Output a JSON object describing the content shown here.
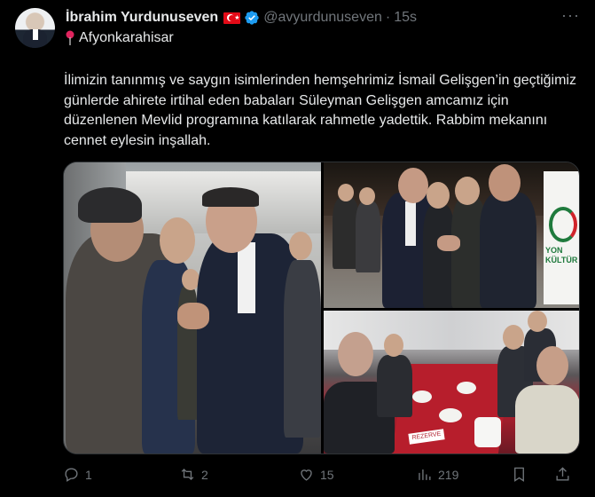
{
  "user": {
    "name": "İbrahim Yurdunuseven",
    "handle": "@avyurdunuseven",
    "time": "15s",
    "location": "Afyonkarahisar"
  },
  "tweet": {
    "text": "İlimizin tanınmış ve saygın isimlerinden hemşehrimiz İsmail Gelişgen’in geçtiğimiz günlerde ahirete irtihal eden babaları Süleyman Gelişgen amcamız için düzenlenen Mevlid programına katılarak rahmetle yadettik. Rabbim mekanını cennet eylesin inşallah."
  },
  "media": {
    "sign_text": "YON\nKÜLTÜR",
    "reserve_text": "REZERVE"
  },
  "actions": {
    "replies": "1",
    "reposts": "2",
    "likes": "15",
    "views": "219"
  },
  "icons": [
    "verified-icon",
    "location-pin-icon",
    "more-icon",
    "reply-icon",
    "repost-icon",
    "like-icon",
    "views-icon",
    "bookmark-icon",
    "share-icon"
  ],
  "colors": {
    "accent": "#1d9bf0",
    "muted": "#71767b",
    "text": "#e7e9ea",
    "bg": "#000000"
  }
}
